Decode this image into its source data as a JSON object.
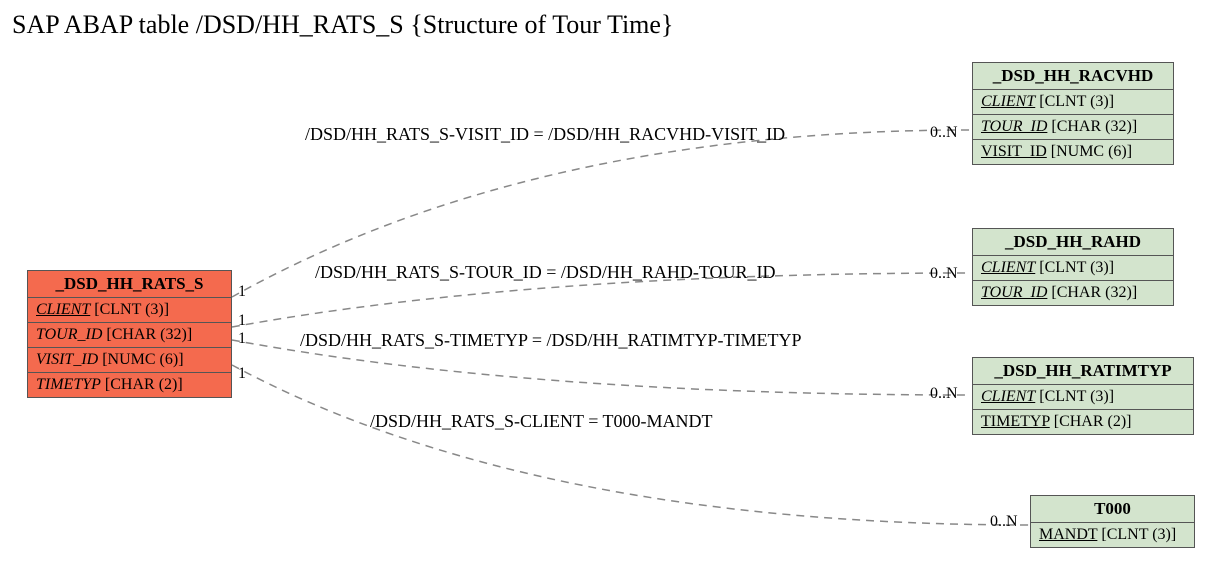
{
  "chart_data": {
    "type": "diagram",
    "title": "SAP ABAP table /DSD/HH_RATS_S {Structure of Tour Time}",
    "main_entity": {
      "name": "_DSD_HH_RATS_S",
      "color": "salmon",
      "fields": [
        {
          "name": "CLIENT",
          "type": "CLNT (3)",
          "italic": true,
          "underline": true
        },
        {
          "name": "TOUR_ID",
          "type": "CHAR (32)",
          "italic": true
        },
        {
          "name": "VISIT_ID",
          "type": "NUMC (6)",
          "italic": true
        },
        {
          "name": "TIMETYP",
          "type": "CHAR (2)",
          "italic": true
        }
      ]
    },
    "related_entities": [
      {
        "name": "_DSD_HH_RACVHD",
        "color": "green",
        "fields": [
          {
            "name": "CLIENT",
            "type": "CLNT (3)",
            "italic": true,
            "underline": true
          },
          {
            "name": "TOUR_ID",
            "type": "CHAR (32)",
            "italic": true,
            "underline": true
          },
          {
            "name": "VISIT_ID",
            "type": "NUMC (6)",
            "underline": true
          }
        ]
      },
      {
        "name": "_DSD_HH_RAHD",
        "color": "green",
        "fields": [
          {
            "name": "CLIENT",
            "type": "CLNT (3)",
            "italic": true,
            "underline": true
          },
          {
            "name": "TOUR_ID",
            "type": "CHAR (32)",
            "italic": true,
            "underline": true
          }
        ]
      },
      {
        "name": "_DSD_HH_RATIMTYP",
        "color": "green",
        "fields": [
          {
            "name": "CLIENT",
            "type": "CLNT (3)",
            "italic": true,
            "underline": true
          },
          {
            "name": "TIMETYP",
            "type": "CHAR (2)",
            "underline": true
          }
        ]
      },
      {
        "name": "T000",
        "color": "green",
        "fields": [
          {
            "name": "MANDT",
            "type": "CLNT (3)",
            "underline": true
          }
        ]
      }
    ],
    "relationships": [
      {
        "label": "/DSD/HH_RATS_S-VISIT_ID = /DSD/HH_RACVHD-VISIT_ID",
        "from_card": "1",
        "to_card": "0..N",
        "to": "_DSD_HH_RACVHD"
      },
      {
        "label": "/DSD/HH_RATS_S-TOUR_ID = /DSD/HH_RAHD-TOUR_ID",
        "from_card": "1",
        "to_card": "0..N",
        "to": "_DSD_HH_RAHD"
      },
      {
        "label": "/DSD/HH_RATS_S-TIMETYP = /DSD/HH_RATIMTYP-TIMETYP",
        "from_card": "1",
        "to_card": "0..N",
        "to": "_DSD_HH_RATIMTYP"
      },
      {
        "label": "/DSD/HH_RATS_S-CLIENT = T000-MANDT",
        "from_card": "1",
        "to_card": "0..N",
        "to": "T000"
      }
    ]
  },
  "title": "SAP ABAP table /DSD/HH_RATS_S {Structure of Tour Time}",
  "leftCards": {
    "c1": "1",
    "c2": "1",
    "c3": "1",
    "c4": "1"
  },
  "rightCards": {
    "c1": "0..N",
    "c2": "0..N",
    "c3": "0..N",
    "c4": "0..N"
  },
  "rel": {
    "r1": "/DSD/HH_RATS_S-VISIT_ID = /DSD/HH_RACVHD-VISIT_ID",
    "r2": "/DSD/HH_RATS_S-TOUR_ID = /DSD/HH_RAHD-TOUR_ID",
    "r3": "/DSD/HH_RATS_S-TIMETYP = /DSD/HH_RATIMTYP-TIMETYP",
    "r4": "/DSD/HH_RATS_S-CLIENT = T000-MANDT"
  },
  "ent": {
    "main": {
      "hdr": "_DSD_HH_RATS_S",
      "f1n": "CLIENT",
      "f1t": " [CLNT (3)]",
      "f2n": "TOUR_ID",
      "f2t": " [CHAR (32)]",
      "f3n": "VISIT_ID",
      "f3t": " [NUMC (6)]",
      "f4n": "TIMETYP",
      "f4t": " [CHAR (2)]"
    },
    "e1": {
      "hdr": "_DSD_HH_RACVHD",
      "f1n": "CLIENT",
      "f1t": " [CLNT (3)]",
      "f2n": "TOUR_ID",
      "f2t": " [CHAR (32)]",
      "f3n": "VISIT_ID",
      "f3t": " [NUMC (6)]"
    },
    "e2": {
      "hdr": "_DSD_HH_RAHD",
      "f1n": "CLIENT",
      "f1t": " [CLNT (3)]",
      "f2n": "TOUR_ID",
      "f2t": " [CHAR (32)]"
    },
    "e3": {
      "hdr": "_DSD_HH_RATIMTYP",
      "f1n": "CLIENT",
      "f1t": " [CLNT (3)]",
      "f2n": "TIMETYP",
      "f2t": " [CHAR (2)]"
    },
    "e4": {
      "hdr": "T000",
      "f1n": "MANDT",
      "f1t": " [CLNT (3)]"
    }
  }
}
